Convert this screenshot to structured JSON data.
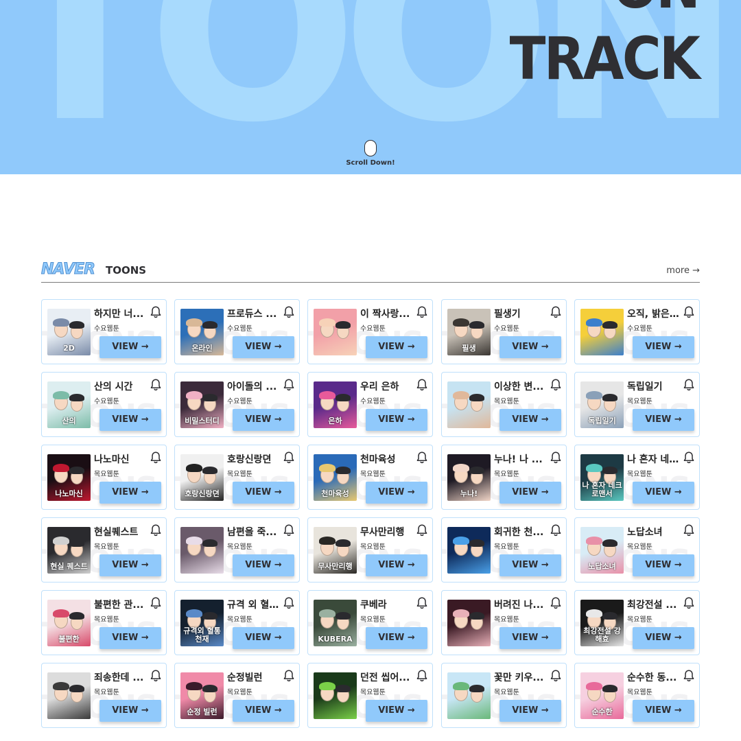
{
  "hero": {
    "background_text": "TOONS",
    "title_line1": "ON",
    "title_line2": "TRACK",
    "scroll_label": "Scroll Down!"
  },
  "section": {
    "brand": "NAVER",
    "name": "TOONS",
    "more_label": "more →"
  },
  "card_watermark": "TOONS",
  "view_label": "VIEW →",
  "colors": {
    "hero_bg": "#90c9fb",
    "accent": "#90c9fb",
    "dark_text": "#2f2f33"
  },
  "cards": [
    {
      "title": "하지만 너...",
      "day": "수요웹툰",
      "thumb_text": "2D",
      "thumb_colors": [
        "#e8eef4",
        "#7a8ba8"
      ]
    },
    {
      "title": "프로듀스 ...",
      "day": "수요웹툰",
      "thumb_text": "온라인",
      "thumb_colors": [
        "#2c6fb8",
        "#d8b897"
      ]
    },
    {
      "title": "이 짝사랑...",
      "day": "수요웹툰",
      "thumb_text": "",
      "thumb_colors": [
        "#f2a0a8",
        "#f7d2b8"
      ]
    },
    {
      "title": "필생기",
      "day": "수요웹툰",
      "thumb_text": "필생",
      "thumb_colors": [
        "#c9c2b8",
        "#3a3632"
      ]
    },
    {
      "title": "오직, 밝은...",
      "day": "수요웹툰",
      "thumb_text": "",
      "thumb_colors": [
        "#f5cf3a",
        "#3c7fcc"
      ]
    },
    {
      "title": "산의 시간",
      "day": "수요웹툰",
      "thumb_text": "산의",
      "thumb_colors": [
        "#ddeef0",
        "#7cbca8"
      ]
    },
    {
      "title": "아이돌의 ...",
      "day": "수요웹툰",
      "thumb_text": "비밀스터디",
      "thumb_colors": [
        "#3b2a3a",
        "#f0b0c4"
      ]
    },
    {
      "title": "우리 은하",
      "day": "수요웹툰",
      "thumb_text": "은하",
      "thumb_colors": [
        "#5a2a8a",
        "#e85a9a"
      ]
    },
    {
      "title": "이상한 변...",
      "day": "목요웹툰",
      "thumb_text": "",
      "thumb_colors": [
        "#c6e3f2",
        "#e0b89a"
      ]
    },
    {
      "title": "독립일기",
      "day": "목요웹툰",
      "thumb_text": "독립일기",
      "thumb_colors": [
        "#e6e6e6",
        "#8aa0b8"
      ]
    },
    {
      "title": "나노마신",
      "day": "목요웹툰",
      "thumb_text": "나노마신",
      "thumb_colors": [
        "#1a0e14",
        "#c01830"
      ]
    },
    {
      "title": "호랑신랑뎐",
      "day": "목요웹툰",
      "thumb_text": "호랑신랑뎐",
      "thumb_colors": [
        "#f0f0f0",
        "#222222"
      ]
    },
    {
      "title": "천마육성",
      "day": "목요웹툰",
      "thumb_text": "천마육성",
      "thumb_colors": [
        "#2a6ab8",
        "#e8c870"
      ]
    },
    {
      "title": "누나! 나 ...",
      "day": "목요웹툰",
      "thumb_text": "누나!",
      "thumb_colors": [
        "#1e1a24",
        "#f2d6c8"
      ]
    },
    {
      "title": "나 혼자 네...",
      "day": "목요웹툰",
      "thumb_text": "나 혼자 네크로맨서",
      "thumb_colors": [
        "#1d3a44",
        "#5ac8c0"
      ]
    },
    {
      "title": "현실퀘스트",
      "day": "목요웹툰",
      "thumb_text": "현실 퀘스트",
      "thumb_colors": [
        "#2a2a2e",
        "#d0d0d0"
      ]
    },
    {
      "title": "남편을 죽...",
      "day": "목요웹툰",
      "thumb_text": "",
      "thumb_colors": [
        "#6a5a6a",
        "#e8dce8"
      ]
    },
    {
      "title": "무사만리행",
      "day": "목요웹툰",
      "thumb_text": "무사만리행",
      "thumb_colors": [
        "#e8e4dc",
        "#2a2824"
      ]
    },
    {
      "title": "회귀한 천...",
      "day": "목요웹툰",
      "thumb_text": "",
      "thumb_colors": [
        "#0e2a5a",
        "#4aa0e8"
      ]
    },
    {
      "title": "노답소녀",
      "day": "목요웹툰",
      "thumb_text": "노답소녀",
      "thumb_colors": [
        "#d8ecf6",
        "#e890a8"
      ]
    },
    {
      "title": "불편한 관...",
      "day": "목요웹툰",
      "thumb_text": "불편한",
      "thumb_colors": [
        "#f4e0e4",
        "#d84a6a"
      ]
    },
    {
      "title": "규격 외 혈...",
      "day": "목요웹툰",
      "thumb_text": "규격외 혈통천재",
      "thumb_colors": [
        "#14202e",
        "#5a8ac8"
      ]
    },
    {
      "title": "쿠베라",
      "day": "목요웹툰",
      "thumb_text": "KUBERA",
      "thumb_colors": [
        "#3a4a3a",
        "#9ab0a0"
      ]
    },
    {
      "title": "버려진 나...",
      "day": "목요웹툰",
      "thumb_text": "",
      "thumb_colors": [
        "#3a1a24",
        "#e8b0b8"
      ]
    },
    {
      "title": "최강전설 ...",
      "day": "목요웹툰",
      "thumb_text": "최강전설 강해효",
      "thumb_colors": [
        "#1a1a1a",
        "#e8e8e8"
      ]
    },
    {
      "title": "죄송한데 ...",
      "day": "목요웹툰",
      "thumb_text": "",
      "thumb_colors": [
        "#dcdcdc",
        "#3a3a3a"
      ]
    },
    {
      "title": "순정빌런",
      "day": "목요웹툰",
      "thumb_text": "순정 빌런",
      "thumb_colors": [
        "#f08aa8",
        "#3a1a2a"
      ]
    },
    {
      "title": "던전 씹어...",
      "day": "목요웹툰",
      "thumb_text": "",
      "thumb_colors": [
        "#1a3a1a",
        "#7ad048"
      ]
    },
    {
      "title": "꽃만 키우...",
      "day": "목요웹툰",
      "thumb_text": "",
      "thumb_colors": [
        "#c8e6f6",
        "#6ab87a"
      ]
    },
    {
      "title": "순수한 동...",
      "day": "목요웹툰",
      "thumb_text": "순수한",
      "thumb_colors": [
        "#f6d0e0",
        "#e86a9a"
      ]
    }
  ]
}
